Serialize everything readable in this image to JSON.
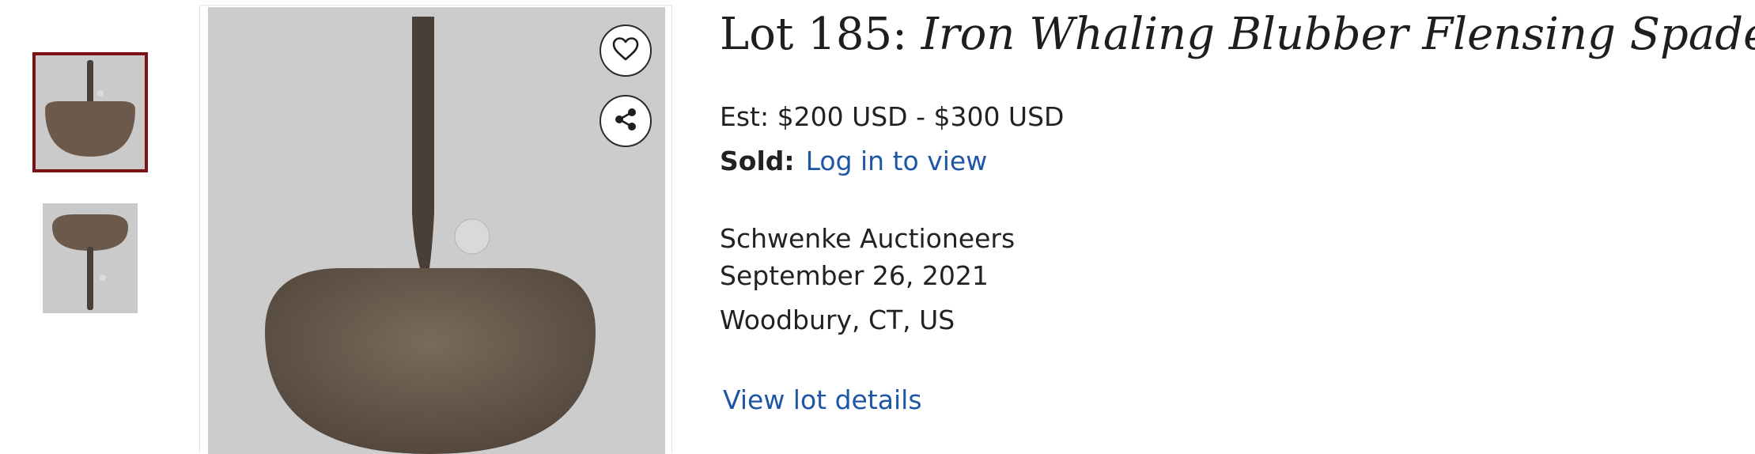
{
  "gallery": {
    "thumbnails": [
      {
        "alt": "thumbnail-1",
        "selected": true
      },
      {
        "alt": "thumbnail-2",
        "selected": false
      }
    ],
    "selected_border_color": "#7a1216",
    "favorite_icon": "heart-icon",
    "share_icon": "share-icon"
  },
  "lot": {
    "prefix": "Lot 185: ",
    "name": "Iron Whaling Blubber Flensing Spade",
    "estimate": "Est: $200 USD - $300 USD",
    "sold_label": "Sold:",
    "sold_link": "Log in to view",
    "auction_house": "Schwenke Auctioneers",
    "date": "September 26, 2021",
    "location": "Woodbury, CT, US",
    "details_link": "View lot details"
  },
  "colors": {
    "link": "#1e56a6",
    "text": "#222222"
  }
}
